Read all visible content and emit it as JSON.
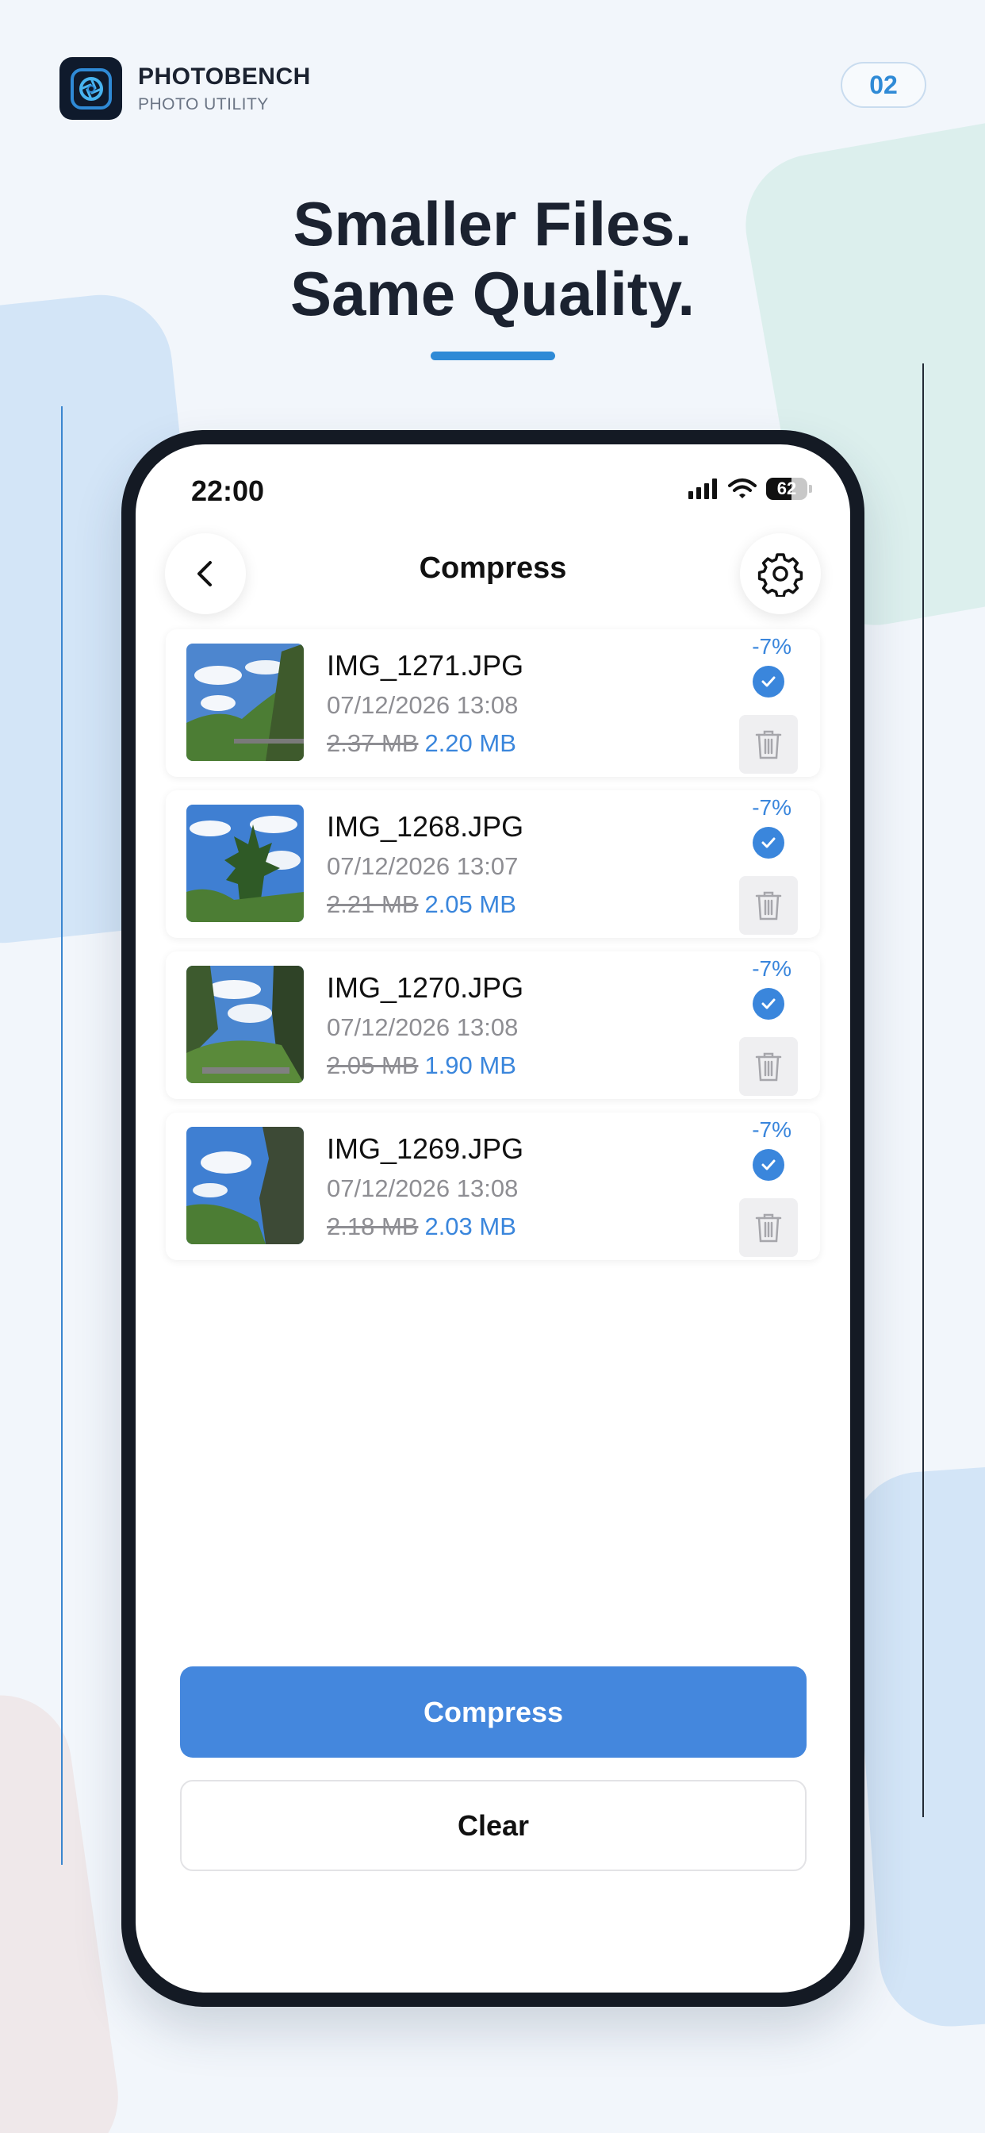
{
  "brand": {
    "name": "PHOTOBENCH",
    "subtitle": "PHOTO UTILITY",
    "icon": "aperture-icon"
  },
  "page_number": "02",
  "headline": {
    "line1": "Smaller Files.",
    "line2": "Same Quality."
  },
  "colors": {
    "accent": "#4487dd",
    "brand_blue": "#2f8ad6",
    "dark": "#141a24"
  },
  "status_bar": {
    "time": "22:00",
    "battery": "62"
  },
  "nav": {
    "title": "Compress",
    "back_icon": "chevron-left-icon",
    "settings_icon": "gear-icon"
  },
  "files": [
    {
      "name": "IMG_1271.JPG",
      "date": "07/12/2026 13:08",
      "old_size": "2.37 MB",
      "new_size": "2.20 MB",
      "percent": "-7%",
      "checked": true
    },
    {
      "name": "IMG_1268.JPG",
      "date": "07/12/2026 13:07",
      "old_size": "2.21 MB",
      "new_size": "2.05 MB",
      "percent": "-7%",
      "checked": true
    },
    {
      "name": "IMG_1270.JPG",
      "date": "07/12/2026 13:08",
      "old_size": "2.05 MB",
      "new_size": "1.90 MB",
      "percent": "-7%",
      "checked": true
    },
    {
      "name": "IMG_1269.JPG",
      "date": "07/12/2026 13:08",
      "old_size": "2.18 MB",
      "new_size": "2.03 MB",
      "percent": "-7%",
      "checked": true
    }
  ],
  "actions": {
    "compress_label": "Compress",
    "clear_label": "Clear"
  }
}
